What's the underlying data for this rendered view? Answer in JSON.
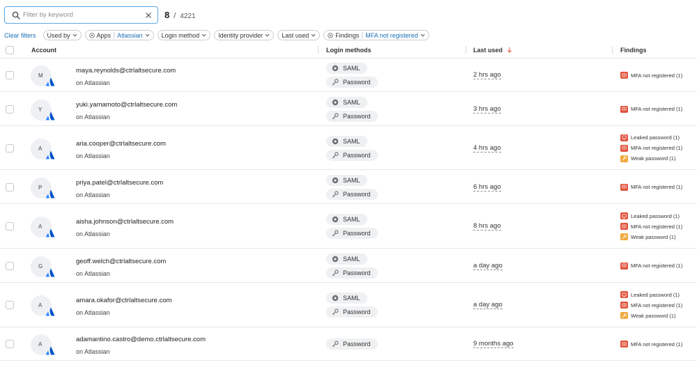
{
  "search": {
    "placeholder": "Filter by keyword",
    "value": ""
  },
  "counts": {
    "shown": "8",
    "separator": "/",
    "total": "4221"
  },
  "filters": {
    "clear_label": "Clear filters",
    "used_by": "Used by",
    "apps_label": "Apps",
    "apps_value": "Atlassian",
    "login_method": "Login method",
    "identity_provider": "Identity provider",
    "last_used": "Last used",
    "findings_label": "Findings",
    "findings_value": "MFA not registered"
  },
  "columns": {
    "account": "Account",
    "login_methods": "Login methods",
    "last_used": "Last used",
    "findings": "Findings"
  },
  "colors": {
    "accent": "#1a6fb5",
    "finding_red": "#e2533d",
    "finding_orange": "#f0a93a",
    "atlassian": "#2684ff"
  },
  "rows": [
    {
      "initial": "M",
      "email": "maya.reynolds@ctrlaltsecure.com",
      "app": "on Atlassian",
      "methods": [
        "SAML",
        "Password"
      ],
      "last_used": "2 hrs ago",
      "findings": [
        {
          "label": "MFA not registered (1)",
          "severity": "red"
        }
      ]
    },
    {
      "initial": "Y",
      "email": "yuki.yamamoto@ctrlaltsecure.com",
      "app": "on Atlassian",
      "methods": [
        "SAML",
        "Password"
      ],
      "last_used": "3 hrs ago",
      "findings": [
        {
          "label": "MFA not registered (1)",
          "severity": "red"
        }
      ]
    },
    {
      "initial": "A",
      "email": "aria.cooper@ctrlaltsecure.com",
      "app": "on Atlassian",
      "methods": [
        "SAML",
        "Password"
      ],
      "last_used": "4 hrs ago",
      "findings": [
        {
          "label": "Leaked password (1)",
          "severity": "red"
        },
        {
          "label": "MFA not registered (1)",
          "severity": "red"
        },
        {
          "label": "Weak password (1)",
          "severity": "orange"
        }
      ]
    },
    {
      "initial": "P",
      "email": "priya.patel@ctrlaltsecure.com",
      "app": "on Atlassian",
      "methods": [
        "SAML",
        "Password"
      ],
      "last_used": "6 hrs ago",
      "findings": [
        {
          "label": "MFA not registered (1)",
          "severity": "red"
        }
      ]
    },
    {
      "initial": "A",
      "email": "aisha.johnson@ctrlaltsecure.com",
      "app": "on Atlassian",
      "methods": [
        "SAML",
        "Password"
      ],
      "last_used": "8 hrs ago",
      "findings": [
        {
          "label": "Leaked password (1)",
          "severity": "red"
        },
        {
          "label": "MFA not registered (1)",
          "severity": "red"
        },
        {
          "label": "Weak password (1)",
          "severity": "orange"
        }
      ]
    },
    {
      "initial": "G",
      "email": "geoff.welch@ctrlaltsecure.com",
      "app": "on Atlassian",
      "methods": [
        "SAML",
        "Password"
      ],
      "last_used": "a day ago",
      "findings": [
        {
          "label": "MFA not registered (1)",
          "severity": "red"
        }
      ]
    },
    {
      "initial": "A",
      "email": "amara.okafor@ctrlaltsecure.com",
      "app": "on Atlassian",
      "methods": [
        "SAML",
        "Password"
      ],
      "last_used": "a day ago",
      "findings": [
        {
          "label": "Leaked password (1)",
          "severity": "red"
        },
        {
          "label": "MFA not registered (1)",
          "severity": "red"
        },
        {
          "label": "Weak password (1)",
          "severity": "orange"
        }
      ]
    },
    {
      "initial": "A",
      "email": "adamantino.castro@demo.ctrlaltsecure.com",
      "app": "on Atlassian",
      "methods": [
        "Password"
      ],
      "last_used": "9 months ago",
      "findings": [
        {
          "label": "MFA not registered (1)",
          "severity": "red"
        }
      ]
    }
  ]
}
